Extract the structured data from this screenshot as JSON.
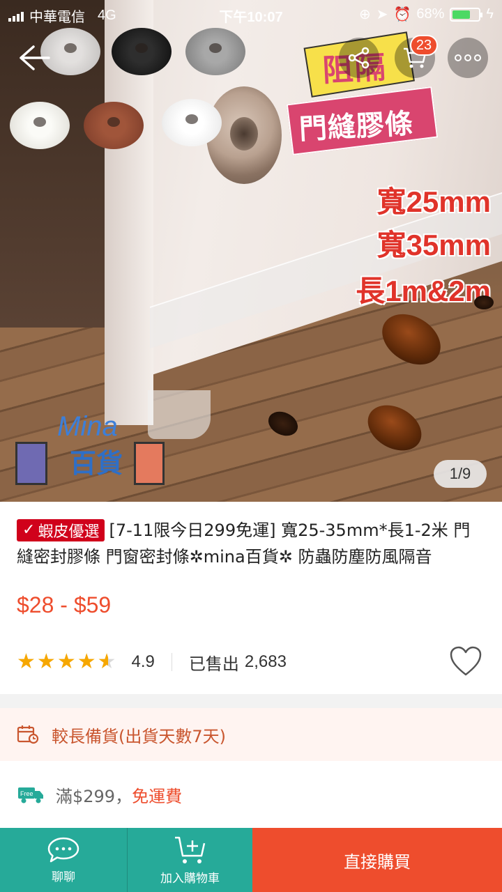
{
  "status_bar": {
    "carrier": "中華電信",
    "network": "4G",
    "time": "下午10:07",
    "battery": "68%",
    "battery_level": 0.68
  },
  "hero": {
    "promo_line1": "阻隔",
    "promo_line2": "門縫膠條",
    "spec1": "寬25mm",
    "spec2": "寬35mm",
    "spec3": "長1m&2m",
    "watermark_en": "Mina",
    "watermark_zh": "百貨",
    "image_counter": "1/9"
  },
  "nav": {
    "cart_count": "23"
  },
  "product": {
    "badge_label": "蝦皮優選",
    "title": "[7-11限今日299免運] 寬25-35mm*長1-2米 門縫密封膠條 門窗密封條✲mina百貨✲ 防蟲防塵防風隔音",
    "price": "$28 - $59",
    "rating": "4.9",
    "rating_value": 4.5,
    "sold_label": "已售出",
    "sold_count": "2,683"
  },
  "shipping": {
    "preorder_text": "較長備貨(出貨天數7天)",
    "free_icon_label": "Free",
    "freeship_prefix": "滿$299，",
    "freeship_link": "免運費"
  },
  "bottom_bar": {
    "chat_label": "聊聊",
    "add_to_cart_label": "加入購物車",
    "buy_now_label": "直接購買"
  },
  "colors": {
    "brand": "#ee4d2d",
    "teal": "#26aa99",
    "star": "#f6a700"
  }
}
